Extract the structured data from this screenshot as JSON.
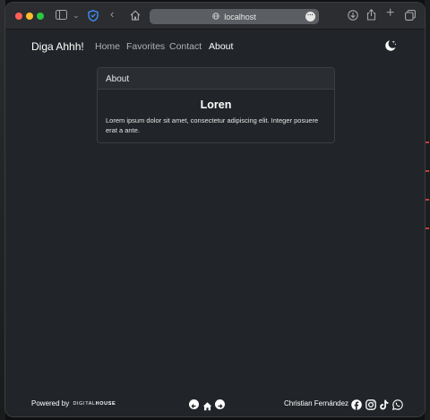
{
  "browser": {
    "url": "localhost"
  },
  "nav": {
    "brand": "Diga Ahhh!",
    "links": [
      {
        "label": "Home",
        "active": false
      },
      {
        "label": "Favorites",
        "active": false
      },
      {
        "label": "Contact",
        "active": false
      },
      {
        "label": "About",
        "active": true
      }
    ],
    "theme_toggle_icon": "moon-stars-icon"
  },
  "card": {
    "header": "About",
    "title": "Loren",
    "text": "Lorem ipsum dolor sit amet, consectetur adipiscing elit. Integer posuere erat a ante."
  },
  "footer": {
    "powered_by": "Powered by",
    "logo_text_regular": "DIGITAL",
    "logo_text_bold": "HOUSE",
    "author": "Christian Fernández",
    "nav_icons": [
      "arrow-left-circle-icon",
      "home-icon",
      "arrow-right-circle-icon"
    ],
    "social_icons": [
      "facebook-icon",
      "instagram-icon",
      "tiktok-icon",
      "whatsapp-icon"
    ]
  },
  "colors": {
    "page_bg": "#212529",
    "toolbar_bg": "#2b2d30",
    "text_primary": "#ffffff",
    "text_muted": "#aeb2b6"
  }
}
